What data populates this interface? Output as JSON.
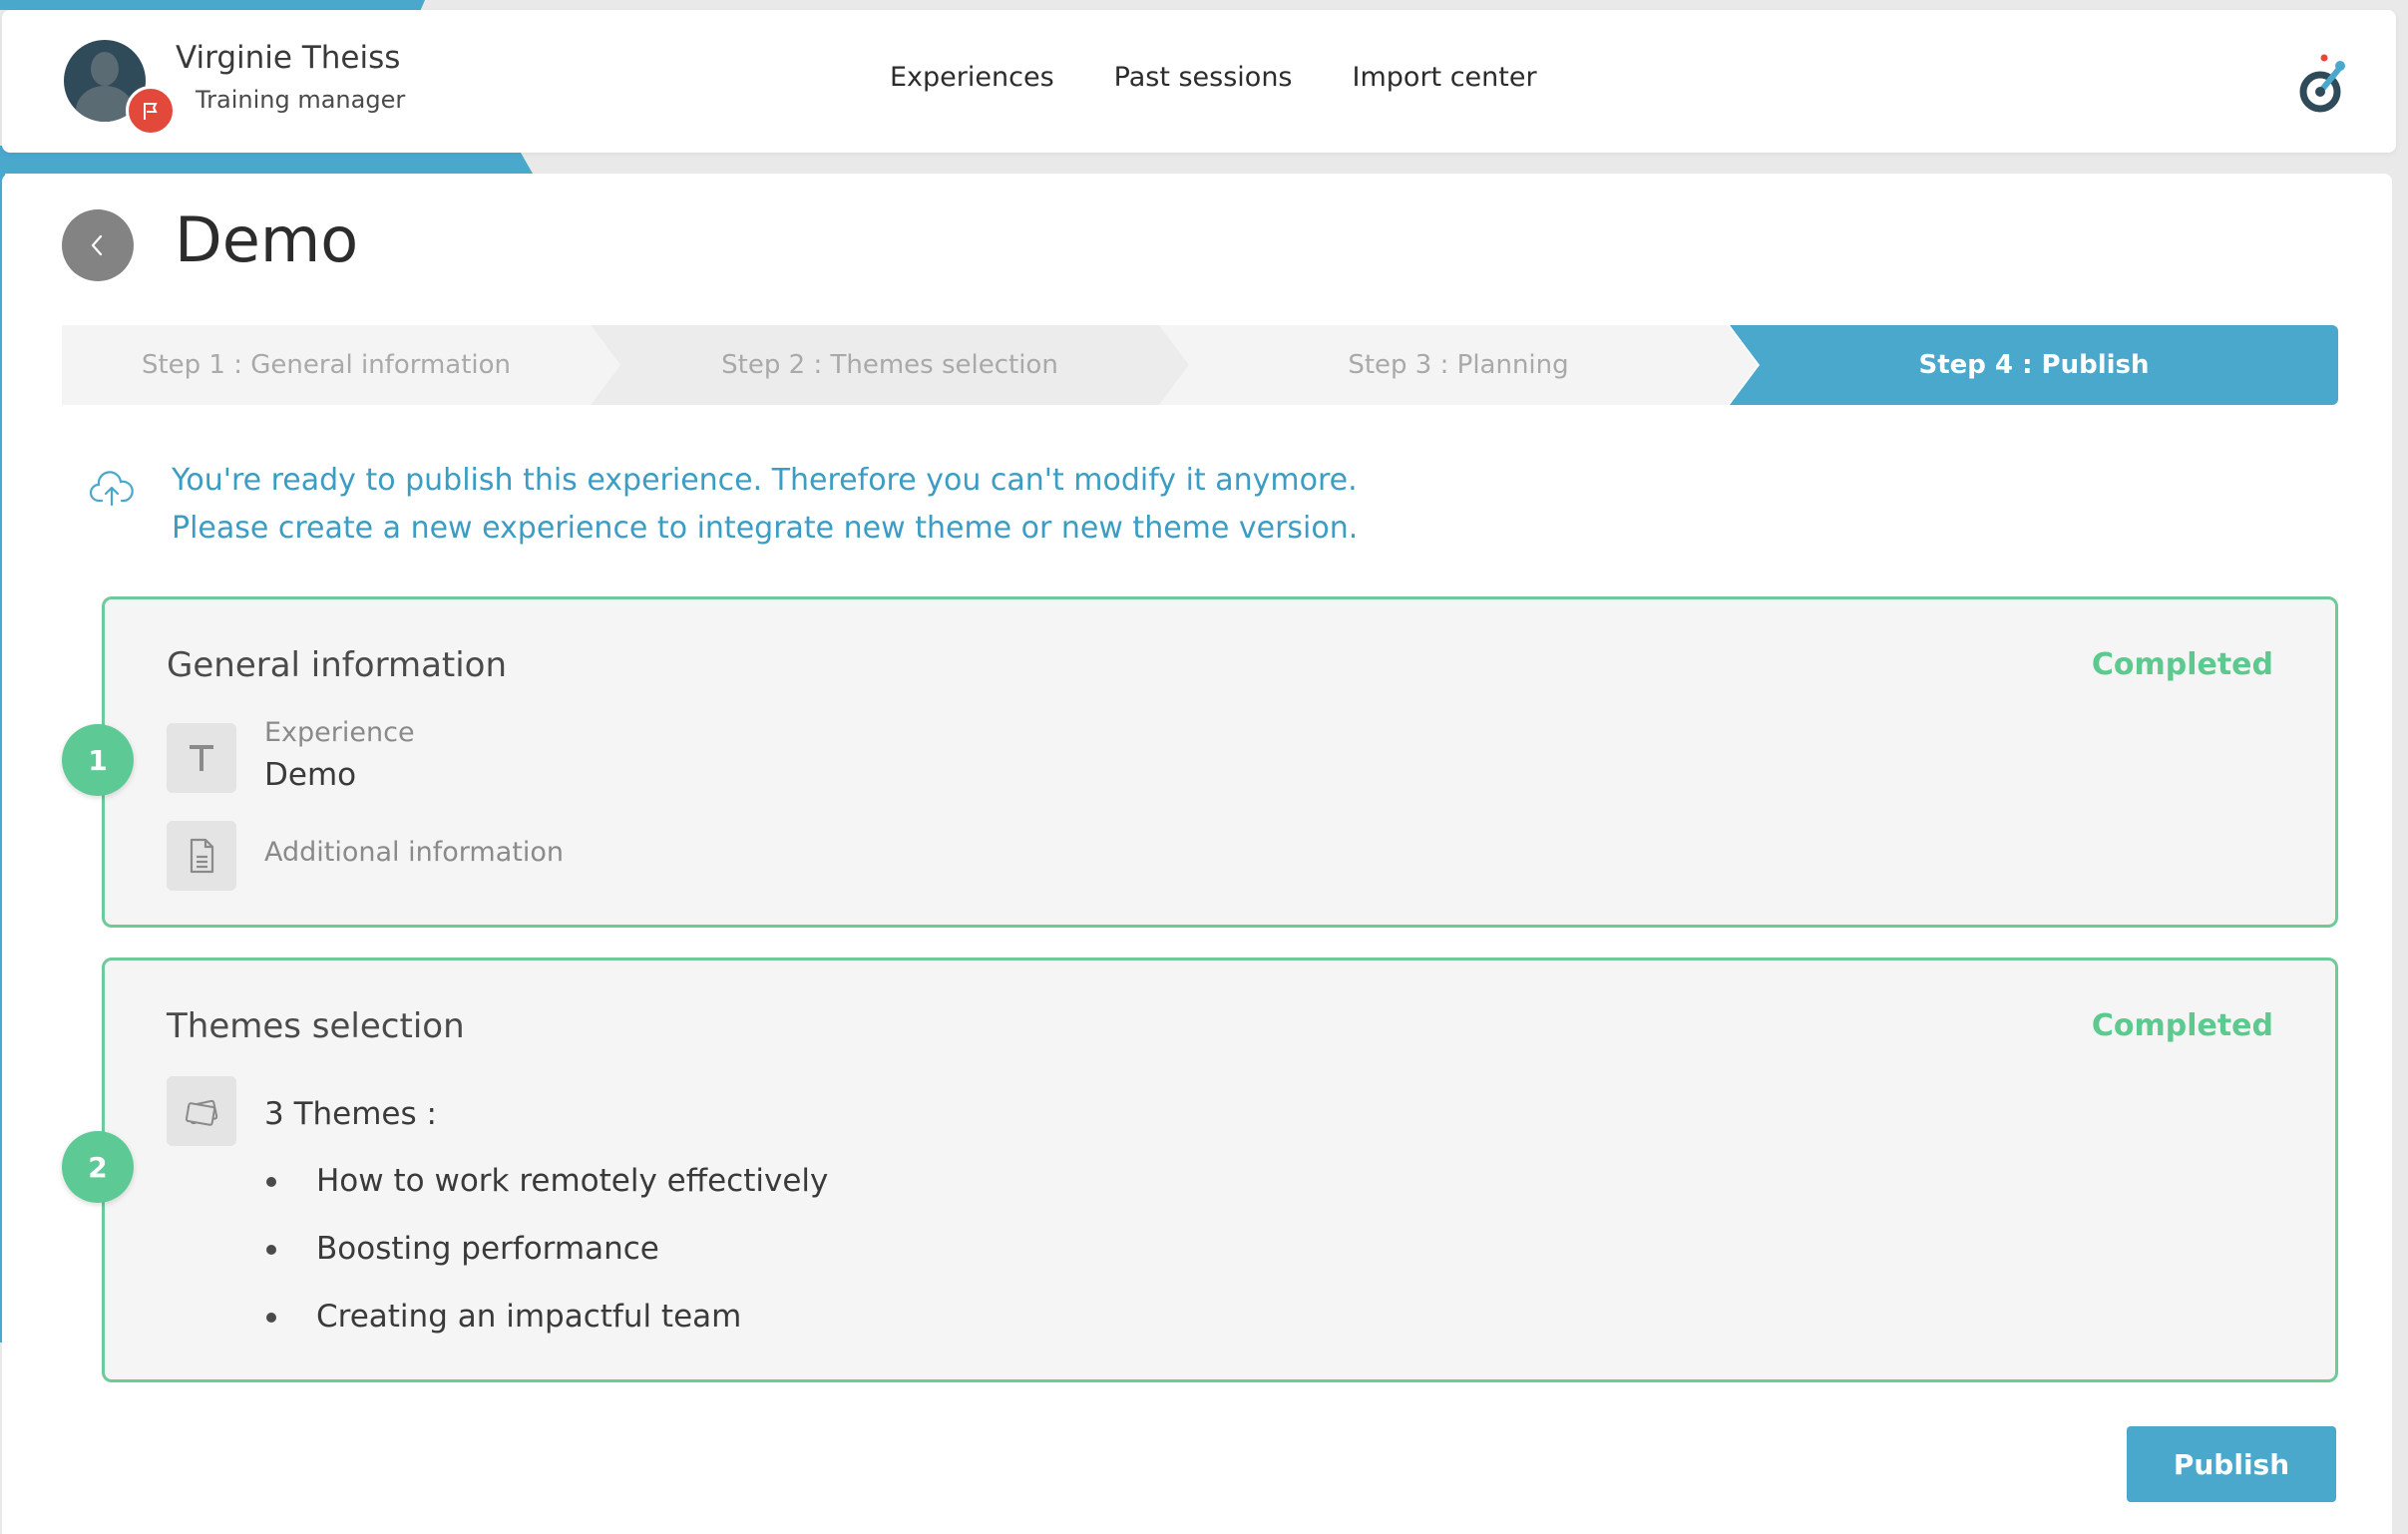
{
  "user": {
    "name": "Virginie Theiss",
    "role": "Training manager"
  },
  "nav": {
    "items": [
      {
        "label": "Experiences"
      },
      {
        "label": "Past sessions"
      },
      {
        "label": "Import center"
      }
    ]
  },
  "page": {
    "title": "Demo"
  },
  "stepper": {
    "steps": [
      {
        "label": "Step 1 : General information",
        "state": "done"
      },
      {
        "label": "Step 2 : Themes selection",
        "state": "done"
      },
      {
        "label": "Step 3 : Planning",
        "state": "done"
      },
      {
        "label": "Step 4 : Publish",
        "state": "active"
      }
    ]
  },
  "notice": {
    "line1": "You're ready to publish this experience. Therefore you can't modify it anymore.",
    "line2": "Please create a new experience to integrate new theme or new theme version."
  },
  "sections": [
    {
      "number": "1",
      "title": "General information",
      "status": "Completed",
      "experience_label": "Experience",
      "experience_value": "Demo",
      "additional_label": "Additional information"
    },
    {
      "number": "2",
      "title": "Themes selection",
      "status": "Completed",
      "themes_count": "3 Themes :",
      "themes": [
        "How to work remotely effectively",
        "Boosting performance",
        "Creating an impactful team"
      ]
    }
  ],
  "actions": {
    "publish_label": "Publish"
  },
  "colors": {
    "accent": "#4aa8cc",
    "success": "#5dc994",
    "badge": "#e2493a"
  }
}
